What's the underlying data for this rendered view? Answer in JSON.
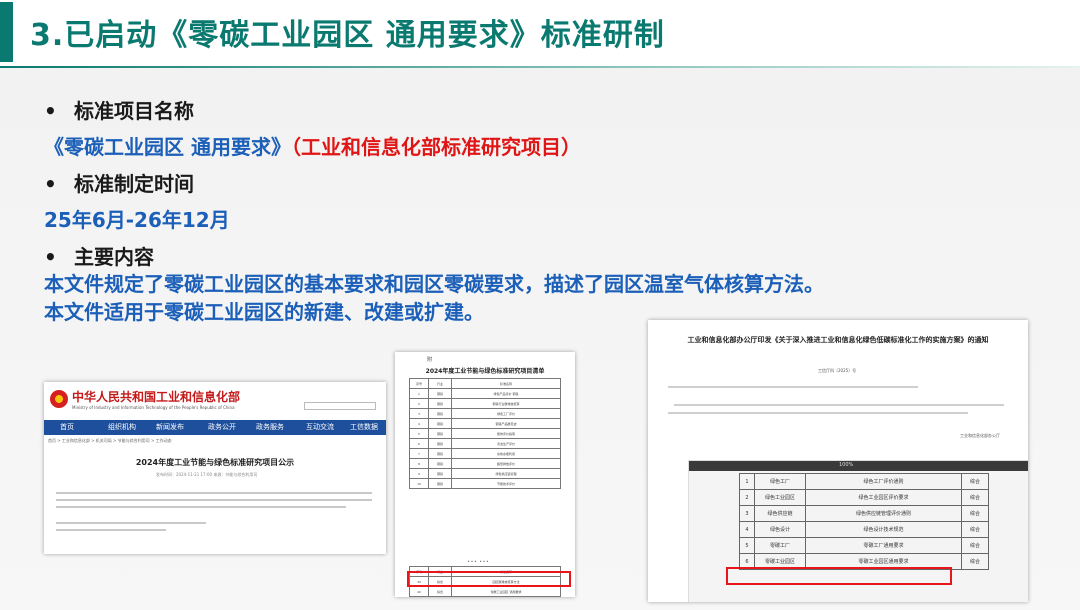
{
  "title": "3.已启动《零碳工业园区 通用要求》标准研制",
  "sections": [
    {
      "heading": "标准项目名称"
    },
    {
      "heading": "标准制定时间"
    },
    {
      "heading": "主要内容"
    }
  ],
  "project_name": {
    "name": "《零碳工业园区 通用要求》",
    "note": "（工业和信息化部标准研究项目）"
  },
  "timeframe": "25年6月-26年12月",
  "content_lines": [
    "本文件规定了零碳工业园区的基本要求和园区零碳要求，描述了园区温室气体核算方法。",
    "本文件适用于零碳工业园区的新建、改建或扩建。"
  ],
  "colors": {
    "accent": "#0a7a70",
    "blue_text": "#1b5fb8",
    "red_text": "#e01515",
    "highlight": "#e8161c"
  },
  "screenshot_ministry": {
    "site_name": "中华人民共和国工业和信息化部",
    "site_name_en": "Ministry of Industry and Information Technology of the People's Republic of China",
    "nav": [
      "首页",
      "组织机构",
      "新闻发布",
      "政务公开",
      "政务服务",
      "互动交流",
      "工信数据"
    ],
    "breadcrumb": "首页 > 工业和信息化部 > 机关司局 > 节能与综合利用司 > 工作动态",
    "article_title": "2024年度工业节能与绿色标准研究项目公示",
    "meta": "发布时间：2024-11-21 17:00 来源：节能与综合利用司"
  },
  "screenshot_list": {
    "attachment": "附",
    "title": "2024年度工业节能与绿色标准研究项目清单",
    "headers": [
      "序号",
      "行业",
      "标准名称"
    ],
    "rows_top": [
      [
        "1",
        "钢铁",
        "绿色产品评价 钢铁"
      ],
      [
        "2",
        "钢铁",
        "钢铁行业碳排放核算"
      ],
      [
        "3",
        "钢铁",
        "绿色工厂评价"
      ],
      [
        "4",
        "钢铁",
        "钢铁产品碳足迹"
      ],
      [
        "5",
        "钢铁",
        "能效评价指南"
      ],
      [
        "6",
        "钢铁",
        "清洁生产评价"
      ],
      [
        "7",
        "钢铁",
        "余热余能利用"
      ],
      [
        "8",
        "钢铁",
        "超低排放评价"
      ],
      [
        "9",
        "钢铁",
        "绿色供应链管理"
      ],
      [
        "10",
        "钢铁",
        "节能技术评价"
      ]
    ],
    "ellipsis": "……",
    "rows_bottom": [
      [
        "39",
        "综合",
        "园区碳排放核算方法"
      ],
      [
        "40",
        "综合",
        "零碳工业园区 通用要求"
      ]
    ]
  },
  "screenshot_notice": {
    "title": "工业和信息化部办公厅印发《关于深入推进工业和信息化绿色低碳标准化工作的实施方案》的通知",
    "doc_number": "工信厅科〔2025〕号",
    "signature": "工业和信息化部办公厅",
    "pdf_zoom": "100%",
    "rows": [
      [
        "1",
        "绿色工厂",
        "绿色工厂评价通则",
        "综合"
      ],
      [
        "2",
        "绿色工业园区",
        "绿色工业园区评价要求",
        "综合"
      ],
      [
        "3",
        "绿色供应链",
        "绿色供应链管理评价通则",
        "综合"
      ],
      [
        "4",
        "绿色设计",
        "绿色设计技术规范",
        "综合"
      ],
      [
        "5",
        "零碳工厂",
        "零碳工厂通用要求",
        "综合"
      ],
      [
        "6",
        "零碳工业园区",
        "零碳工业园区通用要求",
        "综合"
      ]
    ]
  }
}
